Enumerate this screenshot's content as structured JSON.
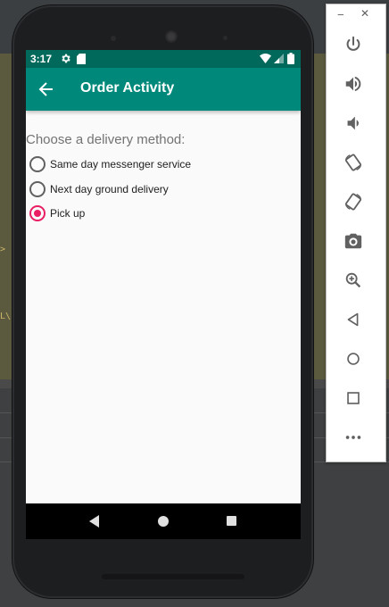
{
  "status_bar": {
    "time": "3:17",
    "icons": [
      "gear-icon",
      "sd-card-icon",
      "wifi-icon",
      "signal-icon",
      "battery-icon"
    ]
  },
  "app_bar": {
    "title": "Order Activity",
    "back_icon": "arrow-back-icon",
    "color": "#00897b",
    "status_color": "#00695c"
  },
  "form": {
    "prompt": "Choose a delivery method:",
    "options": [
      {
        "label": "Same day messenger service",
        "checked": false
      },
      {
        "label": "Next day ground delivery",
        "checked": false
      },
      {
        "label": "Pick up",
        "checked": true
      }
    ],
    "accent_color": "#e91e63"
  },
  "nav_bar": {
    "buttons": [
      "nav-back-icon",
      "nav-home-icon",
      "nav-recents-icon"
    ]
  },
  "emulator_toolbar": {
    "window_controls": [
      "minimize-icon",
      "close-icon"
    ],
    "minimize_glyph": "−",
    "close_glyph": "✕",
    "buttons": [
      "power-icon",
      "volume-up-icon",
      "volume-down-icon",
      "rotate-left-icon",
      "rotate-right-icon",
      "camera-icon",
      "zoom-icon",
      "back-icon",
      "home-icon",
      "overview-icon",
      "more-icon"
    ]
  },
  "ide_background": {
    "marks": [
      ">",
      "L\\"
    ]
  }
}
